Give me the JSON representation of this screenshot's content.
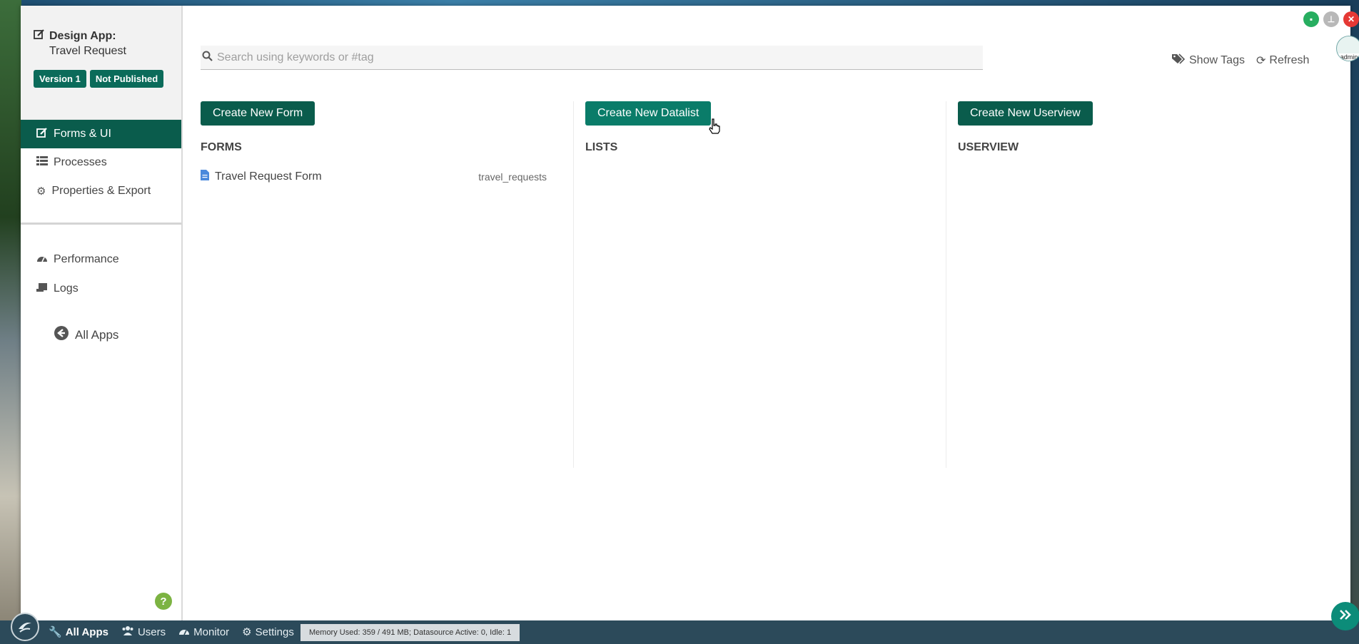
{
  "sidebar": {
    "design_label": "Design App:",
    "app_name": "Travel Request",
    "version_badge": "Version 1",
    "publish_badge": "Not Published",
    "nav": [
      {
        "label": "Forms & UI",
        "icon": "edit-icon",
        "active": true
      },
      {
        "label": "Processes",
        "icon": "list-icon",
        "active": false
      },
      {
        "label": "Properties & Export",
        "icon": "gear-icon",
        "active": false
      }
    ],
    "nav2": [
      {
        "label": "Performance",
        "icon": "dashboard-icon"
      },
      {
        "label": "Logs",
        "icon": "scroll-icon"
      }
    ],
    "all_apps": "All Apps",
    "help": "?"
  },
  "header": {
    "search_placeholder": "Search using keywords or #tag",
    "show_tags": "Show Tags",
    "refresh": "Refresh",
    "avatar_label": "admin"
  },
  "columns": {
    "forms": {
      "button": "Create New Form",
      "title": "FORMS",
      "items": [
        {
          "name": "Travel Request Form",
          "table": "travel_requests"
        }
      ]
    },
    "lists": {
      "button": "Create New Datalist",
      "title": "LISTS"
    },
    "userview": {
      "button": "Create New Userview",
      "title": "USERVIEW"
    }
  },
  "taskbar": {
    "items": [
      "All Apps",
      "Users",
      "Monitor",
      "Settings"
    ],
    "status": "Memory Used: 359 / 491 MB; Datasource Active: 0, Idle: 1"
  },
  "colors": {
    "brand": "#0a5c4c",
    "taskbar": "#2c4a5a"
  }
}
